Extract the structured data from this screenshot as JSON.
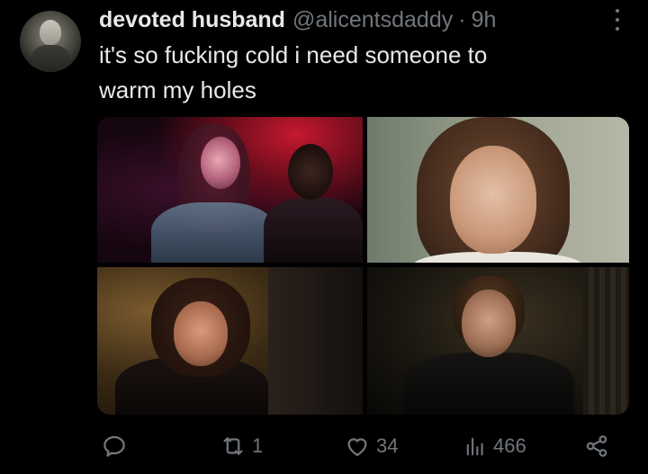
{
  "tweet": {
    "author_name": "devoted husband",
    "author_handle": "@alicentsdaddy",
    "separator": "·",
    "time": "9h",
    "text_lines": [
      "it's so fucking cold i need someone to",
      "warm my holes"
    ]
  },
  "actions": {
    "reply": {
      "icon": "reply-icon",
      "count": ""
    },
    "repost": {
      "icon": "repost-icon",
      "count": "1"
    },
    "like": {
      "icon": "heart-icon",
      "count": "34"
    },
    "views": {
      "icon": "views-icon",
      "count": "466"
    },
    "share": {
      "icon": "share-icon"
    }
  },
  "colors": {
    "background": "#000000",
    "text_primary": "#e7e9ea",
    "text_secondary": "#71767b"
  }
}
